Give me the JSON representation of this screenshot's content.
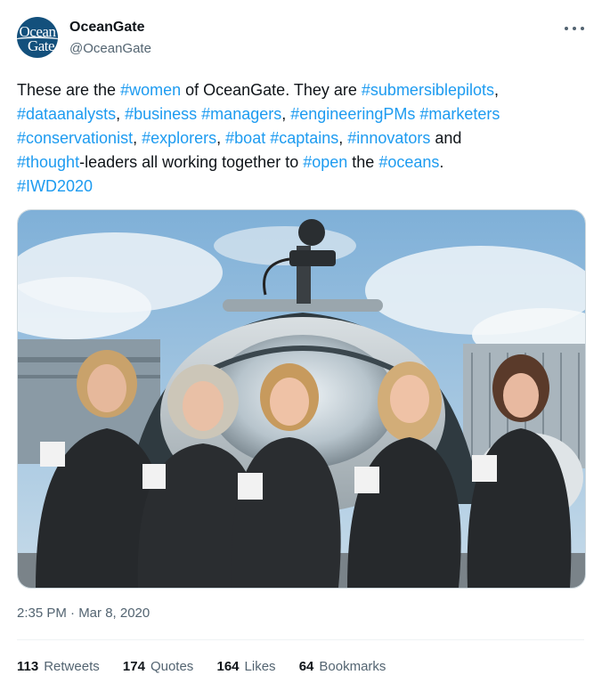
{
  "author": {
    "name": "OceanGate",
    "handle": "@OceanGate",
    "avatar_line1": "Ocean",
    "avatar_line2": "Gate"
  },
  "tweet_lines": [
    [
      {
        "t": "These are the "
      },
      {
        "t": "#women",
        "tag": true
      },
      {
        "t": " of OceanGate. They are "
      },
      {
        "t": "#submersiblepilots",
        "tag": true
      },
      {
        "t": ","
      }
    ],
    [
      {
        "t": "#dataanalysts",
        "tag": true
      },
      {
        "t": ", "
      },
      {
        "t": "#business",
        "tag": true
      },
      {
        "t": " "
      },
      {
        "t": "#managers",
        "tag": true
      },
      {
        "t": ", "
      },
      {
        "t": "#engineeringPMs",
        "tag": true
      },
      {
        "t": " "
      },
      {
        "t": "#marketers",
        "tag": true
      }
    ],
    [
      {
        "t": "#conservationist",
        "tag": true
      },
      {
        "t": ", "
      },
      {
        "t": "#explorers",
        "tag": true
      },
      {
        "t": ", "
      },
      {
        "t": "#boat",
        "tag": true
      },
      {
        "t": " "
      },
      {
        "t": "#captains",
        "tag": true
      },
      {
        "t": ",  "
      },
      {
        "t": "#innovators",
        "tag": true
      },
      {
        "t": " and"
      }
    ],
    [
      {
        "t": "#thought",
        "tag": true
      },
      {
        "t": "-leaders all working together to "
      },
      {
        "t": "#open",
        "tag": true
      },
      {
        "t": " the "
      },
      {
        "t": "#oceans",
        "tag": true
      },
      {
        "t": "."
      }
    ],
    [
      {
        "t": "#IWD2020",
        "tag": true
      }
    ]
  ],
  "timestamp": "2:35 PM · Mar 8, 2020",
  "stats": {
    "retweets_count": "113",
    "retweets_label": "Retweets",
    "quotes_count": "174",
    "quotes_label": "Quotes",
    "likes_count": "164",
    "likes_label": "Likes",
    "bookmarks_count": "64",
    "bookmarks_label": "Bookmarks"
  },
  "colors": {
    "hashtag": "#1d9bf0",
    "text": "#0f1419",
    "secondary": "#536471",
    "avatar_bg": "#13507c"
  }
}
